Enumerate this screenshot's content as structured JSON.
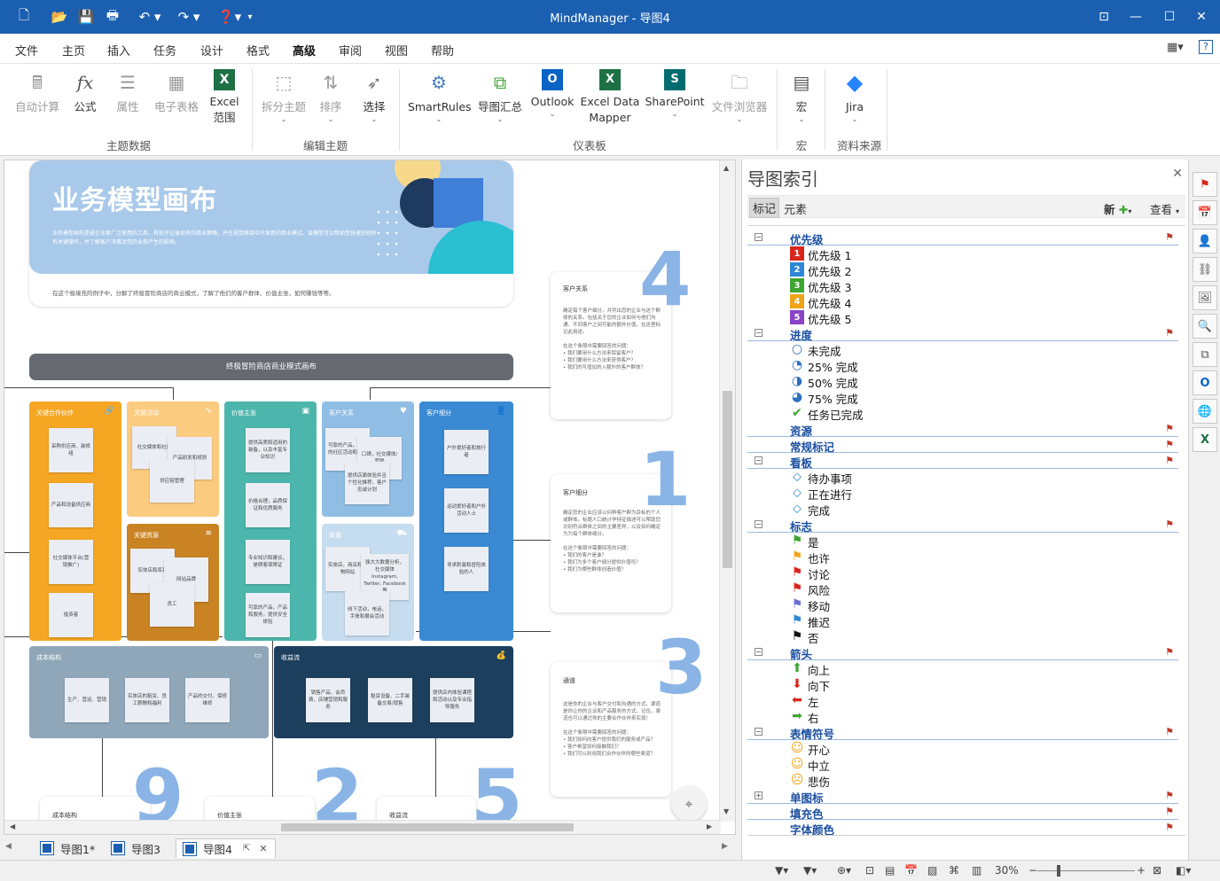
{
  "app": {
    "title": "MindManager - 导图4"
  },
  "ribbon_tabs": [
    "文件",
    "主页",
    "插入",
    "任务",
    "设计",
    "格式",
    "高级",
    "审阅",
    "视图",
    "帮助"
  ],
  "active_tab": "高级",
  "ribbon": {
    "buttons": [
      {
        "label": "自动计算",
        "icon": "auto-calc-icon",
        "disabled": true
      },
      {
        "label": "公式",
        "icon": "fx-icon",
        "disabled": false
      },
      {
        "label": "属性",
        "icon": "properties-icon",
        "disabled": true
      },
      {
        "label": "电子表格",
        "icon": "spreadsheet-icon",
        "disabled": true
      },
      {
        "label": "Excel\n范围",
        "icon": "excel-icon",
        "disabled": false
      },
      {
        "label": "拆分主题",
        "icon": "split-topic-icon",
        "disabled": true
      },
      {
        "label": "排序",
        "icon": "sort-icon",
        "disabled": true
      },
      {
        "label": "选择",
        "icon": "select-cursor-icon",
        "disabled": false
      },
      {
        "label": "SmartRules",
        "icon": "smartrules-icon",
        "disabled": false
      },
      {
        "label": "导图汇总",
        "icon": "map-rollup-icon",
        "disabled": false
      },
      {
        "label": "Outlook",
        "icon": "outlook-icon",
        "disabled": false
      },
      {
        "label": "Excel Data\nMapper",
        "icon": "excel-mapper-icon",
        "disabled": false
      },
      {
        "label": "SharePoint",
        "icon": "sharepoint-icon",
        "disabled": false
      },
      {
        "label": "文件浏览器",
        "icon": "file-browser-icon",
        "disabled": true
      },
      {
        "label": "宏",
        "icon": "macro-icon",
        "disabled": false
      },
      {
        "label": "Jira",
        "icon": "jira-icon",
        "disabled": false
      }
    ],
    "groups": [
      "主题数据",
      "编辑主题",
      "仪表板",
      "宏",
      "资料来源"
    ]
  },
  "canvas": {
    "hero_title": "业务模型画布",
    "hero_desc": "业务模型画布是被企业家广泛使用的工具，有助于记录现有的商业策略，并在视觉框架中开发新的商业模式。该模型可以帮助您快速识别所有关键操作，并了解客户决策对您的业务产生的影响。",
    "hero_foot": "在这个极境充的例子中，分解了终极冒险商店的商业模式，了解了他们的客户群体、价值主张，如何赚钱等等。",
    "canvas_title": "终极冒险商店商业模式画布",
    "side_cards": [
      {
        "num": "4",
        "title": "客户关系",
        "text": "确定每个客户细分，并列出您的企业与这个群体的关系。包括关于您的企业如何与他们沟通、不同客户之间可能的额外价值，在这里标记此用途。\n\n在这个象限中需要回答的问题：\n• 我们要用什么方法来保留客户？\n• 我们要用什么方法来获得客户？\n• 我们的可增加的入额外的客户群体？"
      },
      {
        "num": "1",
        "title": "客户细分",
        "text": "确定您的企业应该以何种客户群为目标的个人或群体。标题人口统计学特征描述可以帮助您识别符合群体之间的主要差异，以及如何确定为为每个群体细分。\n\n在这个象限中需要回答的问题：\n• 我们的客户是谁？\n• 我们为多个客户细分提供价值吗？\n• 我们为哪些群体创造价值？"
      },
      {
        "num": "3",
        "title": "通道",
        "text": "这是你的企业与客户交付和沟通的方式。渠道是你让你的企业和产品服务的方式。记住，渠道也可以通过你的主要合作伙伴来实现！\n\n在这个象限中需要回答的问题：\n• 我们如何向客户提供我们的服务或产品？\n• 客户希望如何接触我们？\n• 我们可以利用我们合作伙伴的哪些渠道？"
      }
    ],
    "blocks": {
      "partners": {
        "title": "关键合作伙伴",
        "notes": [
          "采购供应商、装修组",
          "产品和设备供应商",
          "社交媒体平台(营销推广)",
          "投资者"
        ]
      },
      "activities": {
        "title": "关键活动",
        "notes": [
          "社交媒体和社区",
          "产品研发和规划",
          "供应链管理"
        ]
      },
      "resources": {
        "title": "关键资源",
        "notes": [
          "实体店和库存",
          "网站品牌",
          "员工"
        ]
      },
      "value": {
        "title": "价值主张",
        "notes": [
          "提供高质和适用的装备，以及丰富专业知识",
          "价格合理，品质保证和优质服务",
          "专业知识和建议，是顾客保障证",
          "可靠的产品，产品和服务，提供安全体验"
        ]
      },
      "relations": {
        "title": "客户关系",
        "notes": [
          "可靠的产品，更多的社区活动和服务",
          "口碑，社交媒体/营销",
          "提供店面体验并且个性化推荐，客户忠诚计划"
        ]
      },
      "channels": {
        "title": "渠道",
        "notes": [
          "实体店，商店和购物网站",
          "强大大数据分析，社交媒体Instagram, Twitter, Facebook等",
          "线下活动，电话，手册和展会活动"
        ]
      },
      "segments": {
        "title": "客户细分",
        "notes": [
          "户外爱好者和旅行者",
          "运动爱好者和户外活动人士",
          "寻求刺激和冒险体验的人"
        ]
      },
      "costs": {
        "title": "成本结构",
        "notes": [
          "生产、营运、营销",
          "实体店的租赁、员工薪酬和福利",
          "产品的交付、保修维修"
        ]
      },
      "revenue": {
        "title": "收益流",
        "notes": [
          "销售产品、会员费、店铺营销和服务",
          "租赁设备、二手装备交易/销售",
          "提供店内体验课程和活动以及专业指导服务"
        ]
      }
    },
    "bottom_cards": [
      {
        "num": "9",
        "title": "成本结构"
      },
      {
        "num": "2",
        "title": "价值主张"
      },
      {
        "num": "5",
        "title": "收益流"
      }
    ]
  },
  "doc_tabs": [
    {
      "label": "导图1*",
      "active": false
    },
    {
      "label": "导图3",
      "active": false
    },
    {
      "label": "导图4",
      "active": true
    }
  ],
  "panel": {
    "title": "导图索引",
    "tabs": [
      "标记",
      "元素"
    ],
    "new_label": "新",
    "view_label": "查看",
    "tree": [
      {
        "type": "cat",
        "label": "优先级",
        "expanded": true
      },
      {
        "type": "item",
        "label": "优先级 1",
        "icon": "priority-1-icon",
        "glyph": "1",
        "color": "#d7261e"
      },
      {
        "type": "item",
        "label": "优先级 2",
        "icon": "priority-2-icon",
        "glyph": "2",
        "color": "#2f86d6"
      },
      {
        "type": "item",
        "label": "优先级 3",
        "icon": "priority-3-icon",
        "glyph": "3",
        "color": "#3fa534"
      },
      {
        "type": "item",
        "label": "优先级 4",
        "icon": "priority-4-icon",
        "glyph": "4",
        "color": "#f0a318"
      },
      {
        "type": "item",
        "label": "优先级 5",
        "icon": "priority-5-icon",
        "glyph": "5",
        "color": "#8a43c6"
      },
      {
        "type": "cat",
        "label": "进度",
        "expanded": true
      },
      {
        "type": "item",
        "label": "未完成",
        "icon": "progress-0-icon",
        "glyph": "○",
        "color": "#2f6fc0"
      },
      {
        "type": "item",
        "label": "25% 完成",
        "icon": "progress-25-icon",
        "glyph": "◔",
        "color": "#2f6fc0"
      },
      {
        "type": "item",
        "label": "50% 完成",
        "icon": "progress-50-icon",
        "glyph": "◑",
        "color": "#2f6fc0"
      },
      {
        "type": "item",
        "label": "75% 完成",
        "icon": "progress-75-icon",
        "glyph": "◕",
        "color": "#2f6fc0"
      },
      {
        "type": "item",
        "label": "任务已完成",
        "icon": "task-done-icon",
        "glyph": "✔",
        "color": "#3fa534"
      },
      {
        "type": "cat",
        "label": "资源",
        "expanded": false
      },
      {
        "type": "cat",
        "label": "常规标记",
        "expanded": false
      },
      {
        "type": "cat",
        "label": "看板",
        "expanded": true
      },
      {
        "type": "item",
        "label": "待办事项",
        "icon": "tag-icon",
        "glyph": "⬦",
        "color": "#2f86d6"
      },
      {
        "type": "item",
        "label": "正在进行",
        "icon": "tag-icon",
        "glyph": "⬦",
        "color": "#2f86d6"
      },
      {
        "type": "item",
        "label": "完成",
        "icon": "tag-icon",
        "glyph": "⬦",
        "color": "#2f86d6"
      },
      {
        "type": "cat",
        "label": "标志",
        "expanded": true
      },
      {
        "type": "item",
        "label": "是",
        "icon": "flag-green-icon",
        "glyph": "⚑",
        "color": "#3fa534"
      },
      {
        "type": "item",
        "label": "也许",
        "icon": "flag-orange-icon",
        "glyph": "⚑",
        "color": "#f0a318"
      },
      {
        "type": "item",
        "label": "讨论",
        "icon": "flag-red-icon",
        "glyph": "⚑",
        "color": "#d7261e"
      },
      {
        "type": "item",
        "label": "风险",
        "icon": "flag-red-icon",
        "glyph": "⚑",
        "color": "#d7261e"
      },
      {
        "type": "item",
        "label": "移动",
        "icon": "flag-purple-icon",
        "glyph": "⚑",
        "color": "#6b6fd3"
      },
      {
        "type": "item",
        "label": "推迟",
        "icon": "flag-blue-icon",
        "glyph": "⚑",
        "color": "#2f86d6"
      },
      {
        "type": "item",
        "label": "否",
        "icon": "flag-black-icon",
        "glyph": "⚑",
        "color": "#111111"
      },
      {
        "type": "cat",
        "label": "箭头",
        "expanded": true
      },
      {
        "type": "item",
        "label": "向上",
        "icon": "arrow-up-icon",
        "glyph": "⬆",
        "color": "#3fa534"
      },
      {
        "type": "item",
        "label": "向下",
        "icon": "arrow-down-icon",
        "glyph": "⬇",
        "color": "#d7261e"
      },
      {
        "type": "item",
        "label": "左",
        "icon": "arrow-left-icon",
        "glyph": "⬅",
        "color": "#d7261e"
      },
      {
        "type": "item",
        "label": "右",
        "icon": "arrow-right-icon",
        "glyph": "➡",
        "color": "#3fa534"
      },
      {
        "type": "cat",
        "label": "表情符号",
        "expanded": true
      },
      {
        "type": "item",
        "label": "开心",
        "icon": "smile-icon",
        "glyph": "☺",
        "color": "#f0a318"
      },
      {
        "type": "item",
        "label": "中立",
        "icon": "neutral-icon",
        "glyph": "☺",
        "color": "#f0a318"
      },
      {
        "type": "item",
        "label": "悲伤",
        "icon": "sad-icon",
        "glyph": "☹",
        "color": "#f0a318"
      },
      {
        "type": "cat",
        "label": "单图标",
        "expanded": false,
        "collapsed_box": true
      },
      {
        "type": "cat",
        "label": "填充色",
        "expanded": false
      },
      {
        "type": "cat",
        "label": "字体颜色",
        "expanded": false
      }
    ]
  },
  "status": {
    "zoom": "30%"
  }
}
